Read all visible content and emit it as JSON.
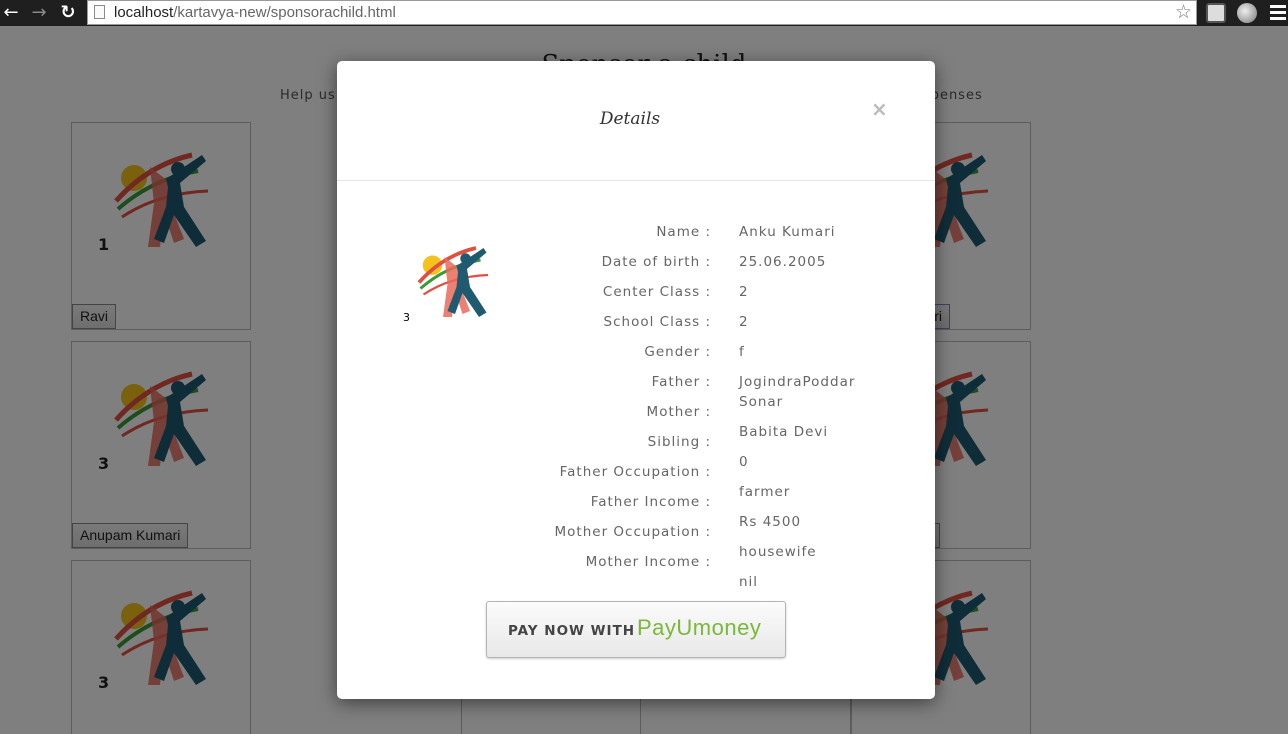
{
  "browser": {
    "url_host": "localhost",
    "url_path": "/kartavya-new/sponsorachild.html"
  },
  "page": {
    "title": "Sponsor a child",
    "subtitle_left": "Help us",
    "subtitle_right": "xpenses",
    "cards": [
      {
        "number": "1",
        "name": "Ravi"
      },
      {
        "number": "3",
        "name": "Anupam Kumari"
      },
      {
        "number": "3",
        "name": ""
      }
    ],
    "right_card_fragment": "ri"
  },
  "modal": {
    "title": "Details",
    "close_symbol": "×",
    "photo_number": "3",
    "labels": [
      "Name :",
      "Date of birth :",
      "Center Class :",
      "School Class :",
      "Gender :",
      "Father :",
      "Mother :",
      "Sibling :",
      "Father Occupation :",
      "Father Income :",
      "Mother Occupation :",
      "Mother Income :"
    ],
    "values": [
      "Anku Kumari",
      "25.06.2005",
      "2",
      "2",
      "f",
      "JogindraPoddar Sonar",
      "Babita Devi",
      "0",
      "farmer",
      "Rs 4500",
      "housewife",
      "nil"
    ],
    "pay_button": {
      "lead": "PAY NOW WITH",
      "brand": "PayUmoney"
    }
  }
}
